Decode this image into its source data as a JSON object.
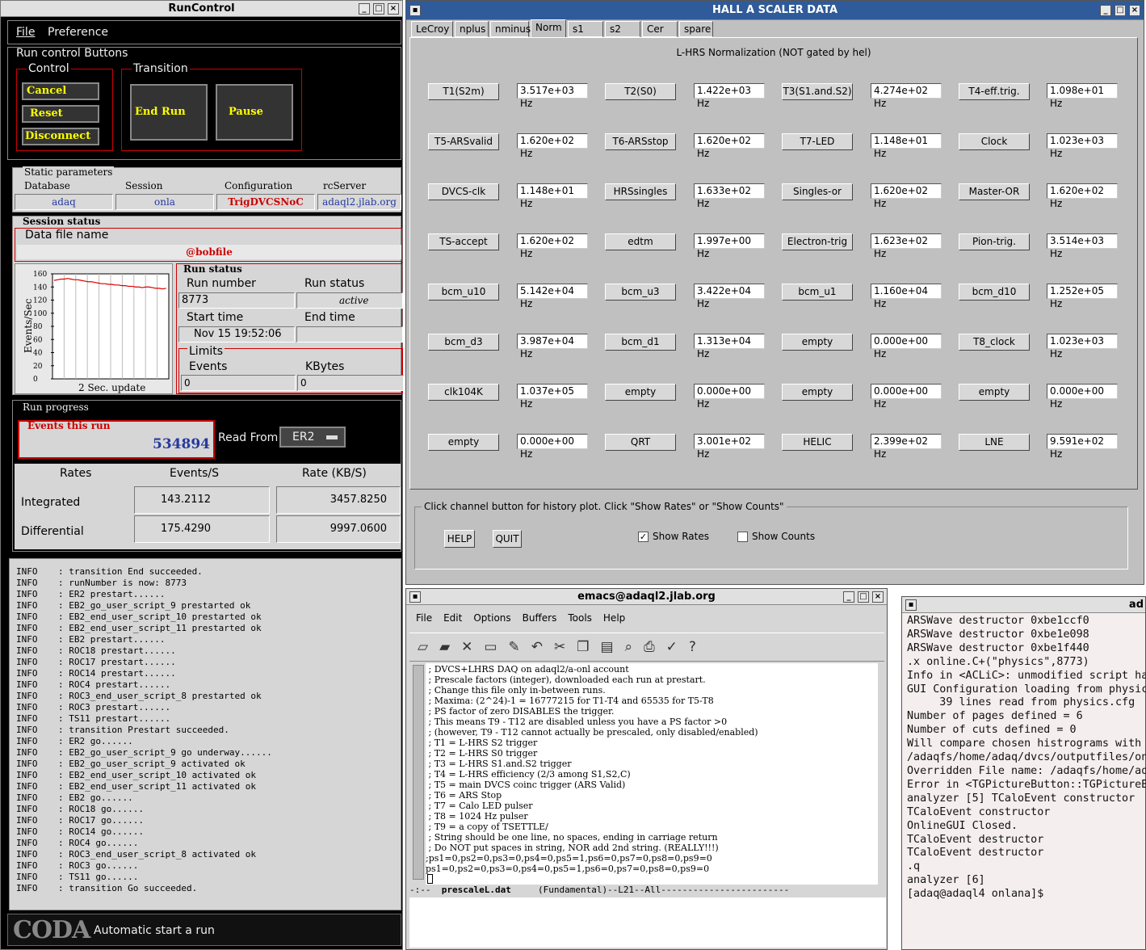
{
  "runcontrol": {
    "title": "RunControl",
    "menu": [
      "File",
      "Preference"
    ],
    "run_control_buttons": "Run control Buttons",
    "control_label": "Control",
    "transition_label": "Transition",
    "cancel": "Cancel",
    "reset": "Reset",
    "disconnect": "Disconnect",
    "end_run": "End Run",
    "pause": "Pause",
    "static_params": "Static parameters",
    "db_h": "Database",
    "sess_h": "Session",
    "cfg_h": "Configuration",
    "srv_h": "rcServer",
    "db": "adaq",
    "sess": "onla",
    "cfg": "TrigDVCSNoC",
    "srv": "adaql2.jlab.org",
    "session_status": "Session status",
    "data_file_name": "Data file name",
    "data_file": "@bobfile",
    "chart_ylabel": "Events/Sec",
    "chart_xlabel": "2 Sec. update",
    "run_status": "Run status",
    "run_number_h": "Run number",
    "run_status_h": "Run status",
    "run_number": "8773",
    "status": "active",
    "start_h": "Start time",
    "end_h": "End time",
    "start": "Nov 15 19:52:06",
    "limits": "Limits",
    "events_h": "Events",
    "kbytes_h": "KBytes",
    "events_v": "0",
    "kbytes_v": "0",
    "run_progress": "Run progress",
    "events_this_run": "Events this run",
    "events_value": "534894",
    "read_from": "Read From:",
    "read_from_val": "ER2",
    "rates_h": "Rates",
    "eps_h": "Events/S",
    "kbs_h": "Rate (KB/S)",
    "integrated": "Integrated",
    "differential": "Differential",
    "int_eps": "143.2112",
    "int_kbs": "3457.8250",
    "diff_eps": "175.4290",
    "diff_kbs": "9997.0600",
    "log": [
      [
        "INFO",
        ": transition End succeeded."
      ],
      [
        "INFO",
        ": runNumber is now: 8773"
      ],
      [
        "INFO",
        ": ER2 prestart......"
      ],
      [
        "INFO",
        ": EB2_go_user_script_9 prestarted ok"
      ],
      [
        "INFO",
        ": EB2_end_user_script_10 prestarted ok"
      ],
      [
        "INFO",
        ": EB2_end_user_script_11 prestarted ok"
      ],
      [
        "INFO",
        ": EB2 prestart......"
      ],
      [
        "INFO",
        ": ROC18 prestart......"
      ],
      [
        "INFO",
        ": ROC17 prestart......"
      ],
      [
        "INFO",
        ": ROC14 prestart......"
      ],
      [
        "INFO",
        ": ROC4 prestart......"
      ],
      [
        "INFO",
        ": ROC3_end_user_script_8 prestarted ok"
      ],
      [
        "INFO",
        ": ROC3 prestart......"
      ],
      [
        "INFO",
        ": TS11 prestart......"
      ],
      [
        "INFO",
        ": transition Prestart succeeded."
      ],
      [
        "INFO",
        ": ER2 go......"
      ],
      [
        "INFO",
        ": EB2_go_user_script_9 go underway......"
      ],
      [
        "INFO",
        ": EB2_go_user_script_9 activated ok"
      ],
      [
        "INFO",
        ": EB2_end_user_script_10 activated ok"
      ],
      [
        "INFO",
        ": EB2_end_user_script_11 activated ok"
      ],
      [
        "INFO",
        ": EB2 go......"
      ],
      [
        "INFO",
        ": ROC18 go......"
      ],
      [
        "INFO",
        ": ROC17 go......"
      ],
      [
        "INFO",
        ": ROC14 go......"
      ],
      [
        "INFO",
        ": ROC4 go......"
      ],
      [
        "INFO",
        ": ROC3_end_user_script_8 activated ok"
      ],
      [
        "INFO",
        ": ROC3 go......"
      ],
      [
        "INFO",
        ": TS11 go......"
      ],
      [
        "INFO",
        ": transition Go succeeded."
      ]
    ],
    "coda": "CODA",
    "status_msg": "Automatic start a run"
  },
  "scaler": {
    "title": "HALL  A  SCALER  DATA",
    "tabs": [
      "LeCroy",
      "nplus",
      "nminus",
      "Norm",
      "s1",
      "s2",
      "Cer",
      "spare"
    ],
    "heading": "L-HRS Normalization (NOT gated by hel)",
    "rows": [
      [
        [
          "T1(S2m)",
          "3.517e+03 Hz"
        ],
        [
          "T2(S0)",
          "1.422e+03 Hz"
        ],
        [
          "T3(S1.and.S2)",
          "4.274e+02 Hz"
        ],
        [
          "T4-eff.trig.",
          "1.098e+01 Hz"
        ]
      ],
      [
        [
          "T5-ARSvalid",
          "1.620e+02 Hz"
        ],
        [
          "T6-ARSstop",
          "1.620e+02 Hz"
        ],
        [
          "T7-LED",
          "1.148e+01 Hz"
        ],
        [
          "Clock",
          "1.023e+03 Hz"
        ]
      ],
      [
        [
          "DVCS-clk",
          "1.148e+01 Hz"
        ],
        [
          "HRSsingles",
          "1.633e+02 Hz"
        ],
        [
          "Singles-or",
          "1.620e+02 Hz"
        ],
        [
          "Master-OR",
          "1.620e+02 Hz"
        ]
      ],
      [
        [
          "TS-accept",
          "1.620e+02 Hz"
        ],
        [
          "edtm",
          "1.997e+00 Hz"
        ],
        [
          "Electron-trig",
          "1.623e+02 Hz"
        ],
        [
          "Pion-trig.",
          "3.514e+03 Hz"
        ]
      ],
      [
        [
          "bcm_u10",
          "5.142e+04 Hz"
        ],
        [
          "bcm_u3",
          "3.422e+04 Hz"
        ],
        [
          "bcm_u1",
          "1.160e+04 Hz"
        ],
        [
          "bcm_d10",
          "1.252e+05 Hz"
        ]
      ],
      [
        [
          "bcm_d3",
          "3.987e+04 Hz"
        ],
        [
          "bcm_d1",
          "1.313e+04 Hz"
        ],
        [
          "empty",
          "0.000e+00 Hz"
        ],
        [
          "T8_clock",
          "1.023e+03 Hz"
        ]
      ],
      [
        [
          "clk104K",
          "1.037e+05 Hz"
        ],
        [
          "empty",
          "0.000e+00 Hz"
        ],
        [
          "empty",
          "0.000e+00 Hz"
        ],
        [
          "empty",
          "0.000e+00 Hz"
        ]
      ],
      [
        [
          "empty",
          "0.000e+00 Hz"
        ],
        [
          "QRT",
          "3.001e+02 Hz"
        ],
        [
          "HELIC",
          "2.399e+02 Hz"
        ],
        [
          "LNE",
          "9.591e+02 Hz"
        ]
      ]
    ],
    "hint": "Click channel button for history plot.  Click \"Show Rates\" or \"Show Counts\"",
    "help": "HELP",
    "quit": "QUIT",
    "show_rates": "Show Rates",
    "show_counts": "Show Counts"
  },
  "emacs": {
    "title": "emacs@adaql2.jlab.org",
    "menu": [
      "File",
      "Edit",
      "Options",
      "Buffers",
      "Tools",
      "Help"
    ],
    "lines": [
      " ; DVCS+LHRS DAQ on adaql2/a-onl account",
      " ; Prescale factors (integer), downloaded each run at prestart.",
      " ; Change this file only in-between runs.",
      " ; Maxima: (2^24)-1 = 16777215 for T1-T4 and 65535 for T5-T8",
      " ; PS factor of zero DISABLES the trigger.",
      " ; This means T9 - T12 are disabled unless you have a PS factor >0",
      " ; (however, T9 - T12 cannot actually be prescaled, only disabled/enabled)",
      " ; T1 = L-HRS S2 trigger",
      " ; T2 = L-HRS S0 trigger",
      " ; T3 = L-HRS S1.and.S2 trigger",
      " ; T4 = L-HRS efficiency (2/3 among S1,S2,C)",
      " ; T5 = main DVCS coinc trigger (ARS Valid)",
      " ; T6 = ARS Stop",
      " ; T7 = Calo LED pulser",
      " ; T8 = 1024 Hz pulser",
      " ; T9 = a copy of TSETTLE/",
      " ; String should be one line, no spaces, ending in carriage return",
      " ; Do NOT put spaces in string, NOR add 2nd string. (REALLY!!!)",
      ";ps1=0,ps2=0,ps3=0,ps4=0,ps5=1,ps6=0,ps7=0,ps8=0,ps9=0",
      "ps1=0,ps2=0,ps3=0,ps4=0,ps5=1,ps6=0,ps7=0,ps8=0,ps9=0"
    ],
    "modeline_pre": "-:--",
    "modeline_file": "prescaleL.dat",
    "modeline_post": "(Fundamental)--L21--All"
  },
  "terminal": {
    "title": "ad",
    "lines": [
      "ARSWave destructor 0xbe1ccf0",
      "ARSWave destructor 0xbe1e098",
      "ARSWave destructor 0xbe1f440",
      ".x online.C+(\"physics\",8773)",
      "Info in <ACLiC>: unmodified script ha",
      "GUI Configuration loading from physic",
      "     39 lines read from physics.cfg",
      "Number of pages defined = 6",
      "Number of cuts defined = 0",
      "Will compare chosen histrograms with",
      "/adaqfs/home/adaq/dvcs/outputfiles/on",
      "Overridden File name: /adaqfs/home/ad",
      "Error in <TGPictureButton::TGPictureB",
      "analyzer [5] TCaloEvent constructor",
      "TCaloEvent constructor",
      "OnlineGUI Closed.",
      "TCaloEvent destructor",
      "TCaloEvent destructor",
      ".q",
      "analyzer [6]",
      "[adaq@adaql4 onlana]$ "
    ]
  }
}
